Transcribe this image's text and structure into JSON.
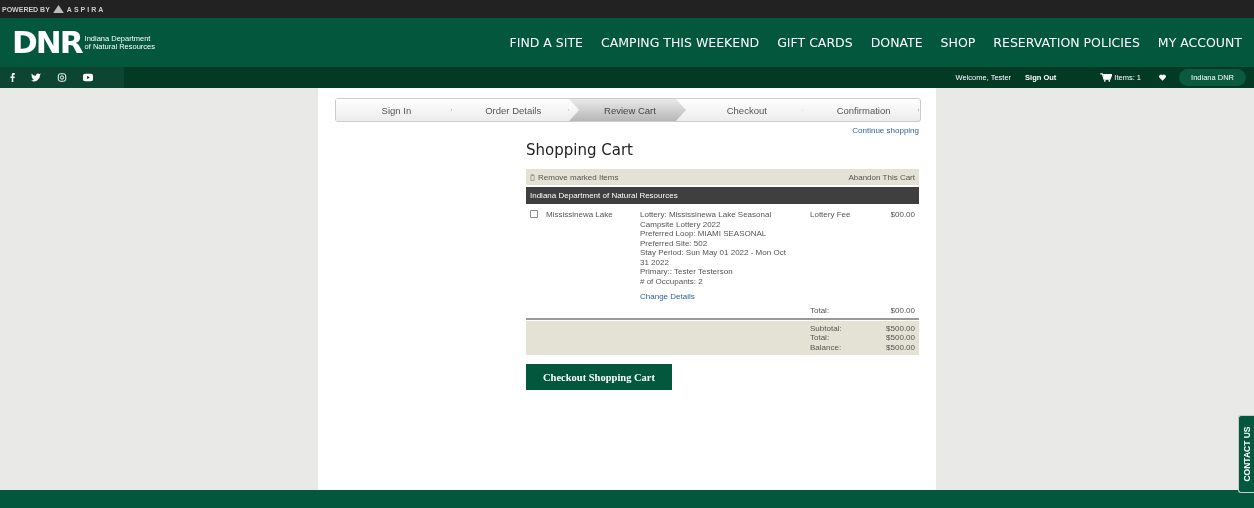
{
  "top_strip": {
    "powered_by": "POWERED BY",
    "vendor": "ASPIRA"
  },
  "header": {
    "logo": "DNR",
    "org_line1": "Indiana Department",
    "org_line2": "of Natural Resources",
    "nav": [
      "FIND A SITE",
      "CAMPING THIS WEEKEND",
      "GIFT CARDS",
      "DONATE",
      "SHOP",
      "RESERVATION POLICIES",
      "MY ACCOUNT"
    ]
  },
  "sub_bar": {
    "welcome": "Welcome, Tester",
    "sign_out": "Sign Out",
    "cart": "Items: 1",
    "account": "Indiana DNR"
  },
  "steps": [
    {
      "label": "Sign In",
      "selected": false
    },
    {
      "label": "Order Details",
      "selected": false
    },
    {
      "label": "Review Cart",
      "selected": true
    },
    {
      "label": "Checkout",
      "selected": false
    },
    {
      "label": "Confirmation",
      "selected": false
    }
  ],
  "continue_link": "Continue shopping",
  "title": "Shopping Cart",
  "toolbar": {
    "remove": "Remove marked Items",
    "abandon": "Abandon This Cart"
  },
  "group_header": "Indiana Department of Natural Resources",
  "items": [
    {
      "checked": false,
      "site": "Mississinewa Lake",
      "details": [
        "Lottery: Mississinewa Lake Seasonal",
        "Campsite Lottery 2022",
        "Preferred Loop: MIAMI SEASONAL",
        "Preferred Site: 502",
        "Stay Period: Sun May 01 2022 - Mon Oct",
        "31 2022",
        "Primary:: Tester Testerson",
        "# of Occupants: 2"
      ],
      "change_link": "Change Details",
      "fee_label": "Lottery Fee",
      "amount": "$00.00"
    }
  ],
  "item_total": {
    "label": "Total:",
    "value": "$00.00"
  },
  "summary": [
    {
      "label": "Subtotal:",
      "value": "$500.00"
    },
    {
      "label": "Total:",
      "value": "$500.00"
    },
    {
      "label": "Balance:",
      "value": "$500.00"
    }
  ],
  "checkout_button": "Checkout Shopping Cart",
  "contact_tab": "CONTACT US"
}
